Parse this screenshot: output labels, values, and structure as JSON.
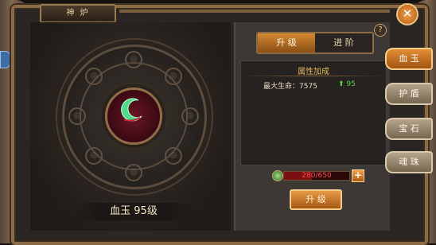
{
  "window": {
    "title": "神 炉",
    "close_symbol": "✕",
    "help_symbol": "?"
  },
  "item": {
    "name": "血玉 95级"
  },
  "tabs": {
    "upgrade": "升 级",
    "advance": "进 阶"
  },
  "attributes": {
    "title": "属性加成",
    "stat_label": "最大生命：7575",
    "stat_gain": "95",
    "gain_arrow": "⬆"
  },
  "progress": {
    "text": "280/650",
    "current": 280,
    "max": 650
  },
  "plus_symbol": "+",
  "upgrade_button": "升 级",
  "side_tabs": [
    {
      "label": "血 玉",
      "active": true
    },
    {
      "label": "护 盾",
      "active": false
    },
    {
      "label": "宝 石",
      "active": false
    },
    {
      "label": "魂 珠",
      "active": false
    }
  ],
  "colors": {
    "accent": "#e38e35",
    "gain": "#5fd04a",
    "progress_text": "#ff4a4a",
    "gold_text": "#e6b85a"
  }
}
